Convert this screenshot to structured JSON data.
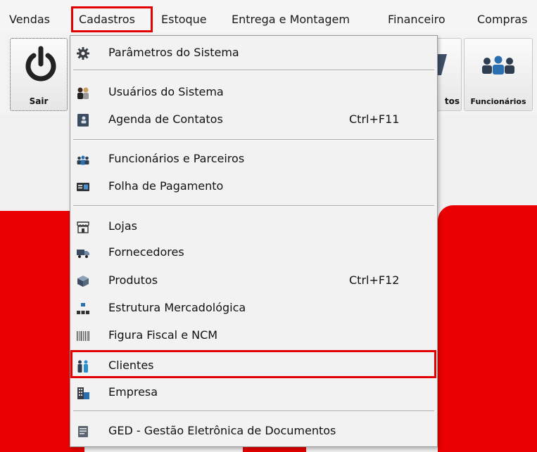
{
  "menubar": {
    "items": [
      "Vendas",
      "Cadastros",
      "Estoque",
      "Entrega e Montagem",
      "Financeiro",
      "Compras"
    ]
  },
  "toolbar": {
    "sair_label": "Sair",
    "contatos_label_partial": "tos",
    "funcionarios_label": "Funcionários"
  },
  "dropdown": {
    "items": [
      {
        "label": "Parâmetros do Sistema",
        "icon": "gear-icon"
      },
      {
        "label": "Usuários do Sistema",
        "icon": "users-icon"
      },
      {
        "label": "Agenda de Contatos",
        "shortcut": "Ctrl+F11",
        "icon": "address-book-icon"
      },
      {
        "label": "Funcionários e Parceiros",
        "icon": "team-icon"
      },
      {
        "label": "Folha de Pagamento",
        "icon": "payroll-icon"
      },
      {
        "label": "Lojas",
        "icon": "store-icon"
      },
      {
        "label": "Fornecedores",
        "icon": "truck-icon"
      },
      {
        "label": "Produtos",
        "shortcut": "Ctrl+F12",
        "icon": "box-icon"
      },
      {
        "label": "Estrutura Mercadológica",
        "icon": "hierarchy-icon"
      },
      {
        "label": "Figura Fiscal e NCM",
        "icon": "barcode-icon"
      },
      {
        "label": "Clientes",
        "icon": "clients-icon"
      },
      {
        "label": "Empresa",
        "icon": "building-icon"
      },
      {
        "label": "GED - Gestão Eletrônica de Documentos",
        "icon": "document-icon"
      }
    ]
  },
  "colors": {
    "highlight": "#e30000",
    "brand_red": "#ea0000"
  }
}
